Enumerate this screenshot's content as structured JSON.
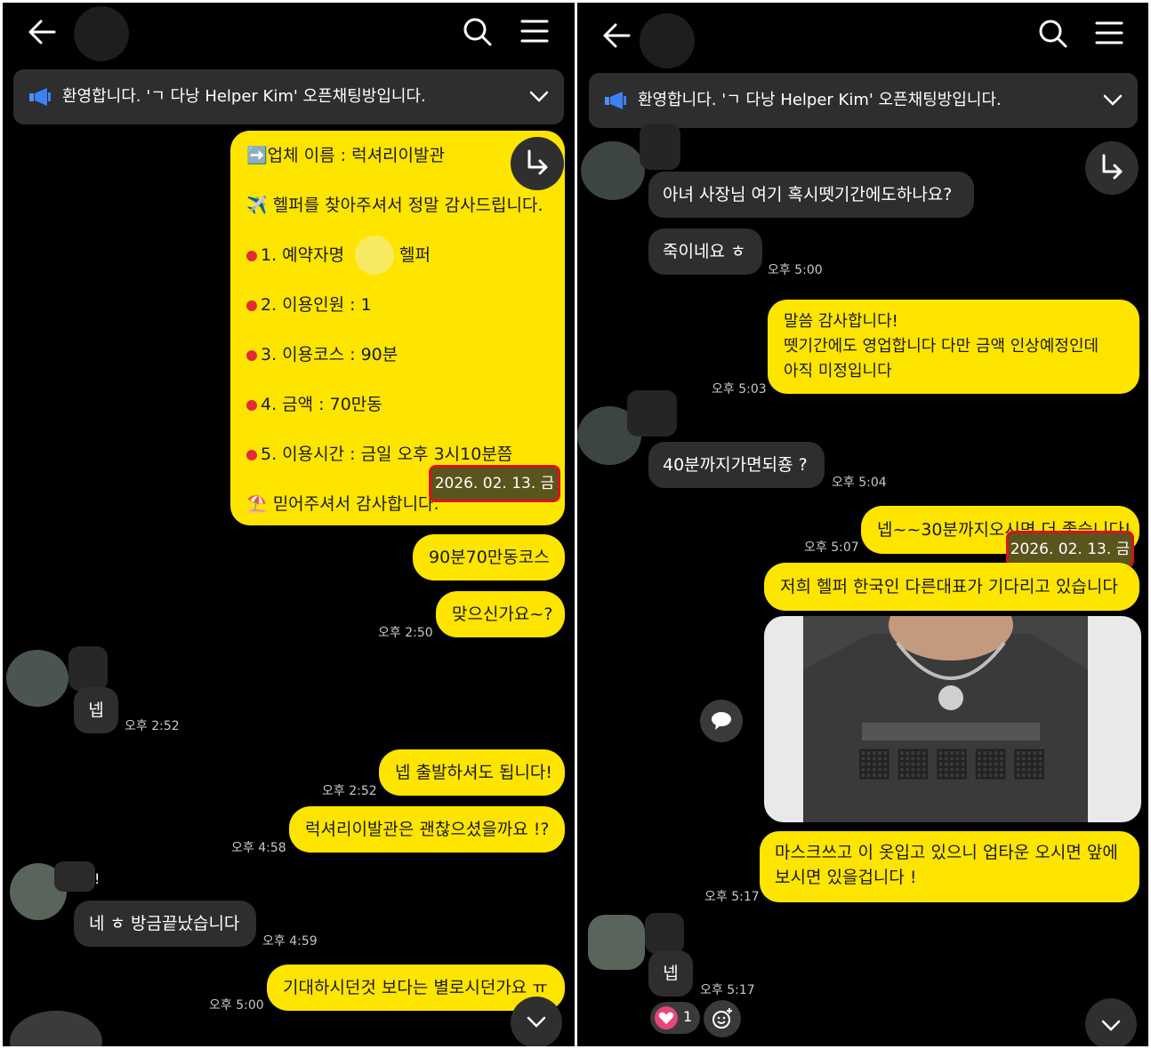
{
  "left": {
    "banner": "환영합니다. 'ㄱ 다낭 Helper Kim' 오픈채팅방입니다.",
    "post_lines": [
      "➡️업체 이름 : 럭셔리이발관",
      "✈️ 헬퍼를 찾아주셔서 정말 감사드립니다.",
      "1. 예약자명",
      "헬퍼",
      "2. 이용인원 :  1",
      "3. 이용코스 :  90분",
      "4. 금액 : 70만동",
      "5. 이용시간 : 금일 오후 3시10분쯤",
      "⛱️ 믿어주셔서 감사합니다."
    ],
    "date_stamp": "2026. 02. 13. 금",
    "messages": [
      {
        "text": "90분70만동코스"
      },
      {
        "text": "맞으신가요~?",
        "time": "오후 2:50"
      },
      {
        "text": "넵",
        "time": "오후 2:52"
      },
      {
        "text": "넵 출발하셔도 됩니다!",
        "time": "오후 2:52"
      },
      {
        "text": "럭셔리이발관은 괜찮으셨을까요 !?",
        "time": "오후 4:58"
      },
      {
        "text": "네 ㅎ 방금끝났습니다",
        "time": "오후 4:59"
      },
      {
        "text": "기대하시던것 보다는 별로시던가요 ㅠ",
        "time": "오후 5:00"
      }
    ],
    "sender_mark": "!"
  },
  "right": {
    "banner": "환영합니다. 'ㄱ 다낭 Helper Kim' 오픈채팅방입니다.",
    "messages": [
      {
        "text": "아녀 사장님 여기 혹시뗏기간에도하나요?"
      },
      {
        "text": "죽이네요 ㅎ",
        "time": "오후 5:00"
      },
      {
        "lines": [
          "말씀 감사합니다!",
          "뗏기간에도 영업합니다 다만 금액 인상예정인데",
          "아직 미정입니다"
        ],
        "time": "오후 5:03"
      },
      {
        "text": "40분까지가면되죵 ?",
        "time": "오후 5:04"
      },
      {
        "text": "넵~~30분까지오시면 더 좋습니다!",
        "time": "오후 5:07"
      },
      {
        "text": "저희 헬퍼 한국인 다른대표가 기다리고 있습니다"
      },
      {
        "lines": [
          "마스크쓰고 이 옷입고 있으니 업타운 오시면 앞에",
          "보시면 있을겁니다 !"
        ],
        "time": "오후 5:17"
      },
      {
        "text": "넵",
        "time": "오후 5:17"
      }
    ],
    "date_stamp": "2026. 02. 13. 금",
    "reaction_count": "1"
  },
  "colors": {
    "bubble_yellow": "#fee500",
    "bubble_dark": "#2e2e2e",
    "highlight_red": "#d8121a",
    "background": "#000000"
  }
}
